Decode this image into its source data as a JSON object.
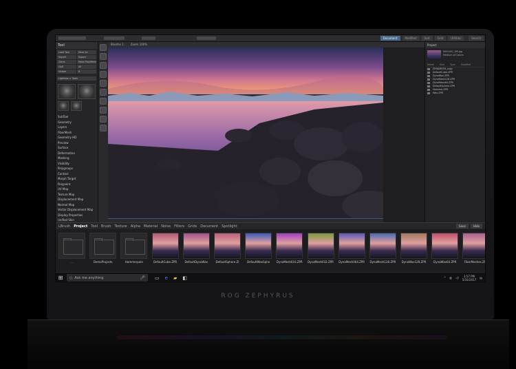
{
  "window": {
    "title": "ZBrush"
  },
  "top_tabs": [
    "Document",
    "Modified",
    "Sort",
    "Grid",
    "Utilities",
    "Preferences"
  ],
  "top_search_label": "Search",
  "left_panel": {
    "title": "Tool",
    "buttons": [
      "Load Tool",
      "Save As",
      "Import",
      "Export",
      "Clone",
      "Make PolyMesh3D",
      "GoZ",
      "All",
      "Visible",
      "R",
      "Lightbox > Tools"
    ],
    "menu_items": [
      "SubTool",
      "Geometry",
      "Layers",
      "FiberMesh",
      "Geometry HD",
      "Preview",
      "Surface",
      "Deformation",
      "Masking",
      "Visibility",
      "Polygroups",
      "Contact",
      "Morph Target",
      "Polypaint",
      "UV Map",
      "Texture Map",
      "Displacement Map",
      "Normal Map",
      "Vector Displacement Map",
      "Display Properties",
      "Unified Skin",
      "Import",
      "Export"
    ]
  },
  "viewport": {
    "doc_tab": "Bluefox 1",
    "zoom_label": "Zoom 100%"
  },
  "right_panel": {
    "title": "Project",
    "preview_name": "IMG0001_DR.jpg",
    "preview_meta": "Medium of Colors",
    "columns": [
      "Name",
      "Size",
      "Type",
      "Modified"
    ],
    "files": [
      "DYNAMESH_copy",
      "DefaultCube.ZPR",
      "DynaWax.ZPR",
      "DynaMesh128.ZPR",
      "DynaMesh64.ZPR",
      "DefaultSphere.ZPR",
      "Hammer.ZPR",
      "Wax.ZPR"
    ]
  },
  "browser": {
    "tabs": [
      "LBrush",
      "Project",
      "Tool",
      "Brush",
      "Texture",
      "Alpha",
      "Material",
      "Noise",
      "Filters",
      "Grids",
      "Document",
      "Spotlight"
    ],
    "active_tab": "Project",
    "tools": [
      "Save",
      "Hide"
    ],
    "tiles": [
      {
        "label": "..",
        "kind": "folder"
      },
      {
        "label": "DemoProjects",
        "kind": "folder"
      },
      {
        "label": "Hammerpole",
        "kind": "folder"
      },
      {
        "label": "DefaultCube.ZPR",
        "kind": "image",
        "hue": "#b05a78"
      },
      {
        "label": "DefaultDynaWax",
        "kind": "image",
        "hue": "#a0508a"
      },
      {
        "label": "DefaultSphere.ZI",
        "kind": "image",
        "hue": "#b8607a"
      },
      {
        "label": "DefaultWaxSphe",
        "kind": "image",
        "hue": "#3a5ab8"
      },
      {
        "label": "DynaMesh016.ZPR",
        "kind": "image",
        "hue": "#a040c0"
      },
      {
        "label": "DynaMesh032.ZPR",
        "kind": "image",
        "hue": "#7a9a40"
      },
      {
        "label": "DynaMesh064.ZPR",
        "kind": "image",
        "hue": "#5a58b8"
      },
      {
        "label": "DynaMesh128.ZPR",
        "kind": "image",
        "hue": "#4a6ab0"
      },
      {
        "label": "DynaWax128.ZPR",
        "kind": "image",
        "hue": "#a07a60"
      },
      {
        "label": "DynaWax64.ZPR",
        "kind": "image",
        "hue": "#c0506a"
      },
      {
        "label": "FiberMeshes.ZPR",
        "kind": "image",
        "hue": "#a86090"
      }
    ]
  },
  "taskbar": {
    "search_placeholder": "Ask me anything",
    "time": "3:57 PM",
    "date": "5/31/2017"
  },
  "brand": "ROG ZEPHYRUS"
}
